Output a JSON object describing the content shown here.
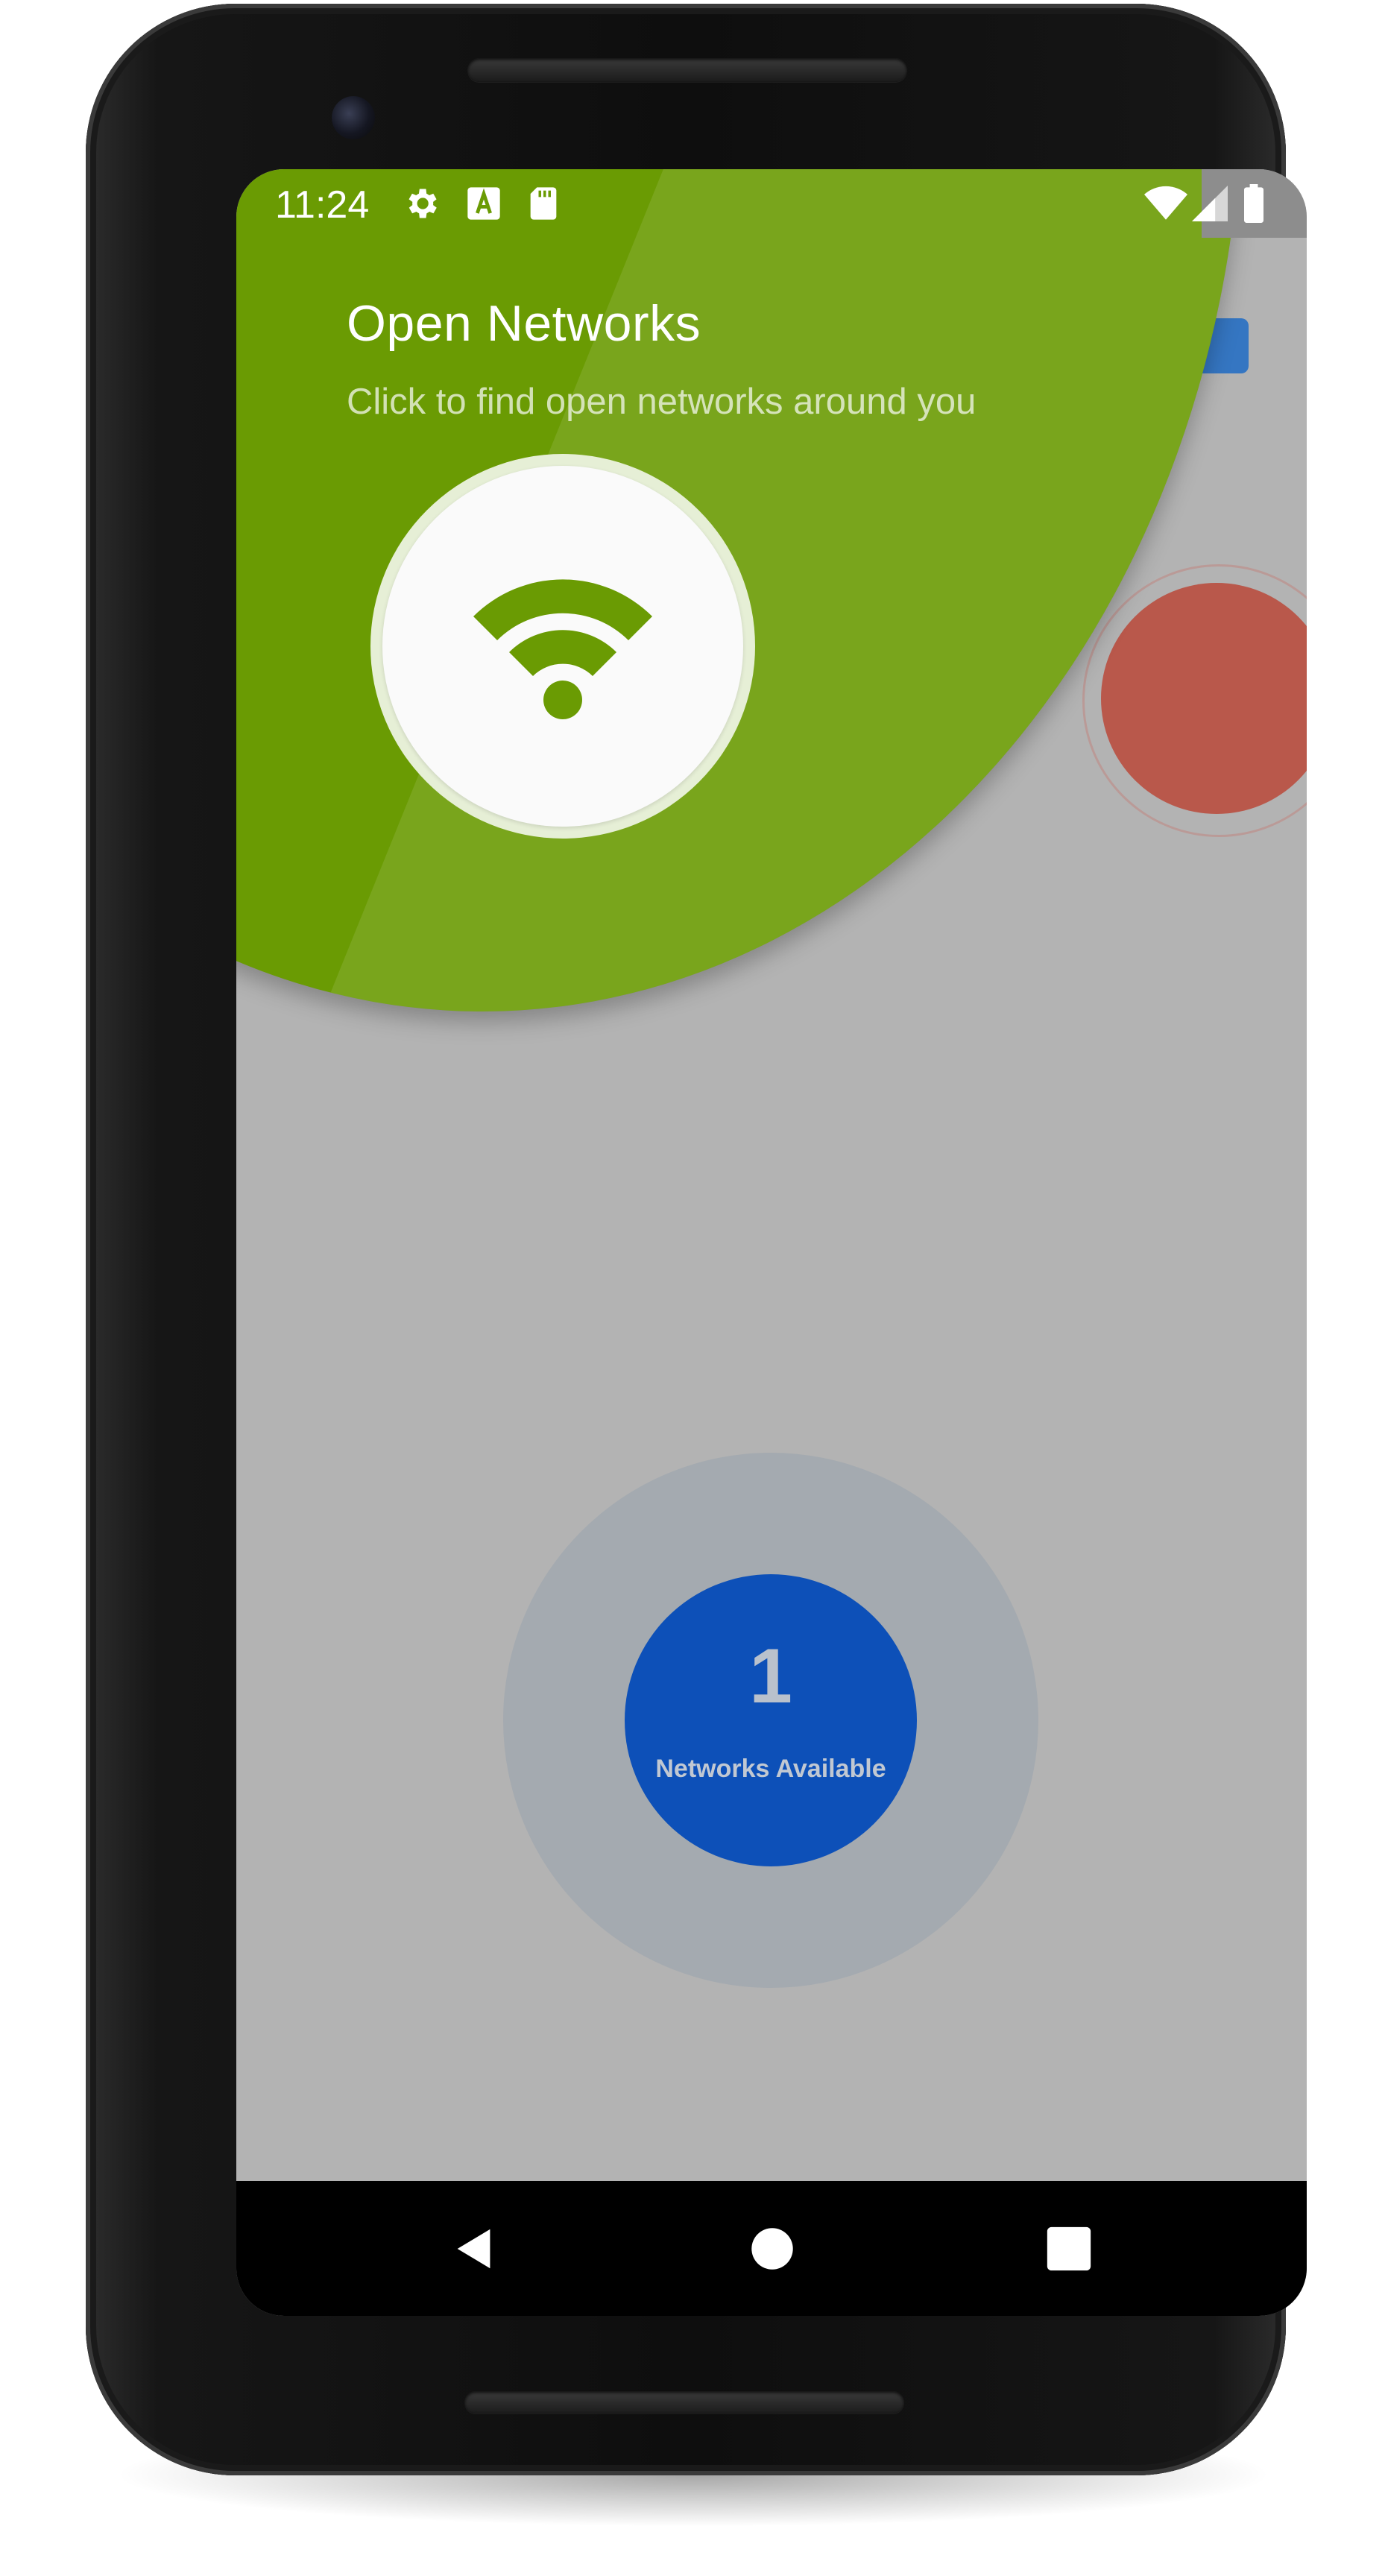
{
  "status_bar": {
    "time": "11:24",
    "icons_left": [
      "gear-icon",
      "text-a-icon",
      "sd-card-icon"
    ],
    "icons_right": [
      "wifi-signal-icon",
      "cell-signal-icon",
      "battery-icon"
    ]
  },
  "tutorial": {
    "title": "Open Networks",
    "subtitle": "Click to find open networks around you",
    "target_icon": "wifi-icon",
    "spotlight_color": "#6a9b03"
  },
  "background_app": {
    "networks": {
      "count": "1",
      "label": "Networks Available",
      "circle_color": "#0d50b8"
    },
    "toggle_color": "#b94e3f",
    "badge_color": "#1f6bc4"
  },
  "nav_bar": {
    "buttons": [
      "back-icon",
      "home-icon",
      "recents-icon"
    ]
  }
}
